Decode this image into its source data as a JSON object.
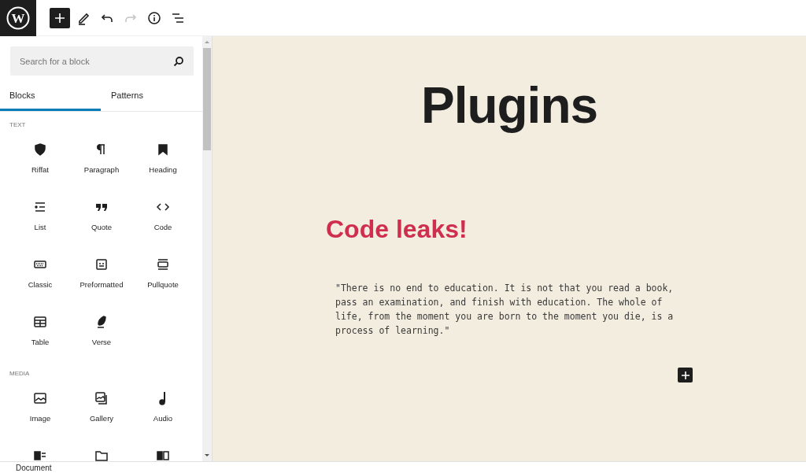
{
  "logo": {
    "mark": "W"
  },
  "toolbar": {
    "buttons": [
      {
        "kind": "inserter",
        "selected": true,
        "disabled": false
      },
      {
        "kind": "edit",
        "selected": false,
        "disabled": false
      },
      {
        "kind": "undo",
        "selected": false,
        "disabled": false
      },
      {
        "kind": "redo",
        "selected": false,
        "disabled": true
      },
      {
        "kind": "info",
        "selected": false,
        "disabled": false
      },
      {
        "kind": "outline",
        "selected": false,
        "disabled": false
      }
    ]
  },
  "sidebar": {
    "search": {
      "placeholder": "Search for a block"
    },
    "tabs": [
      {
        "label": "Blocks",
        "selected": true
      },
      {
        "label": "Patterns",
        "selected": false
      }
    ],
    "sections": [
      {
        "title": "TEXT",
        "blocks": [
          {
            "label": "Riffat",
            "kind": "shield"
          },
          {
            "label": "Paragraph",
            "kind": "paragraph"
          },
          {
            "label": "Heading",
            "kind": "bookmark"
          },
          {
            "label": "List",
            "kind": "list"
          },
          {
            "label": "Quote",
            "kind": "quote"
          },
          {
            "label": "Code",
            "kind": "code"
          },
          {
            "label": "Classic",
            "kind": "keyboard"
          },
          {
            "label": "Preformatted",
            "kind": "preformatted"
          },
          {
            "label": "Pullquote",
            "kind": "pullquote"
          },
          {
            "label": "Table",
            "kind": "table"
          },
          {
            "label": "Verse",
            "kind": "feather"
          }
        ]
      },
      {
        "title": "MEDIA",
        "blocks": [
          {
            "label": "Image",
            "kind": "image"
          },
          {
            "label": "Gallery",
            "kind": "gallery"
          },
          {
            "label": "Audio",
            "kind": "audio"
          },
          {
            "kind": "media-text"
          },
          {
            "kind": "folder"
          },
          {
            "kind": "columns"
          }
        ]
      }
    ]
  },
  "canvas": {
    "title": "Plugins",
    "heading": "Code leaks!",
    "quote": "\"There is no end to education. It is not that you read a book, pass an examination, and finish with education. The whole of life, from the moment you are born to the moment you die, is a process of learning.\""
  },
  "status_bar": {
    "breadcrumb": "Document"
  }
}
